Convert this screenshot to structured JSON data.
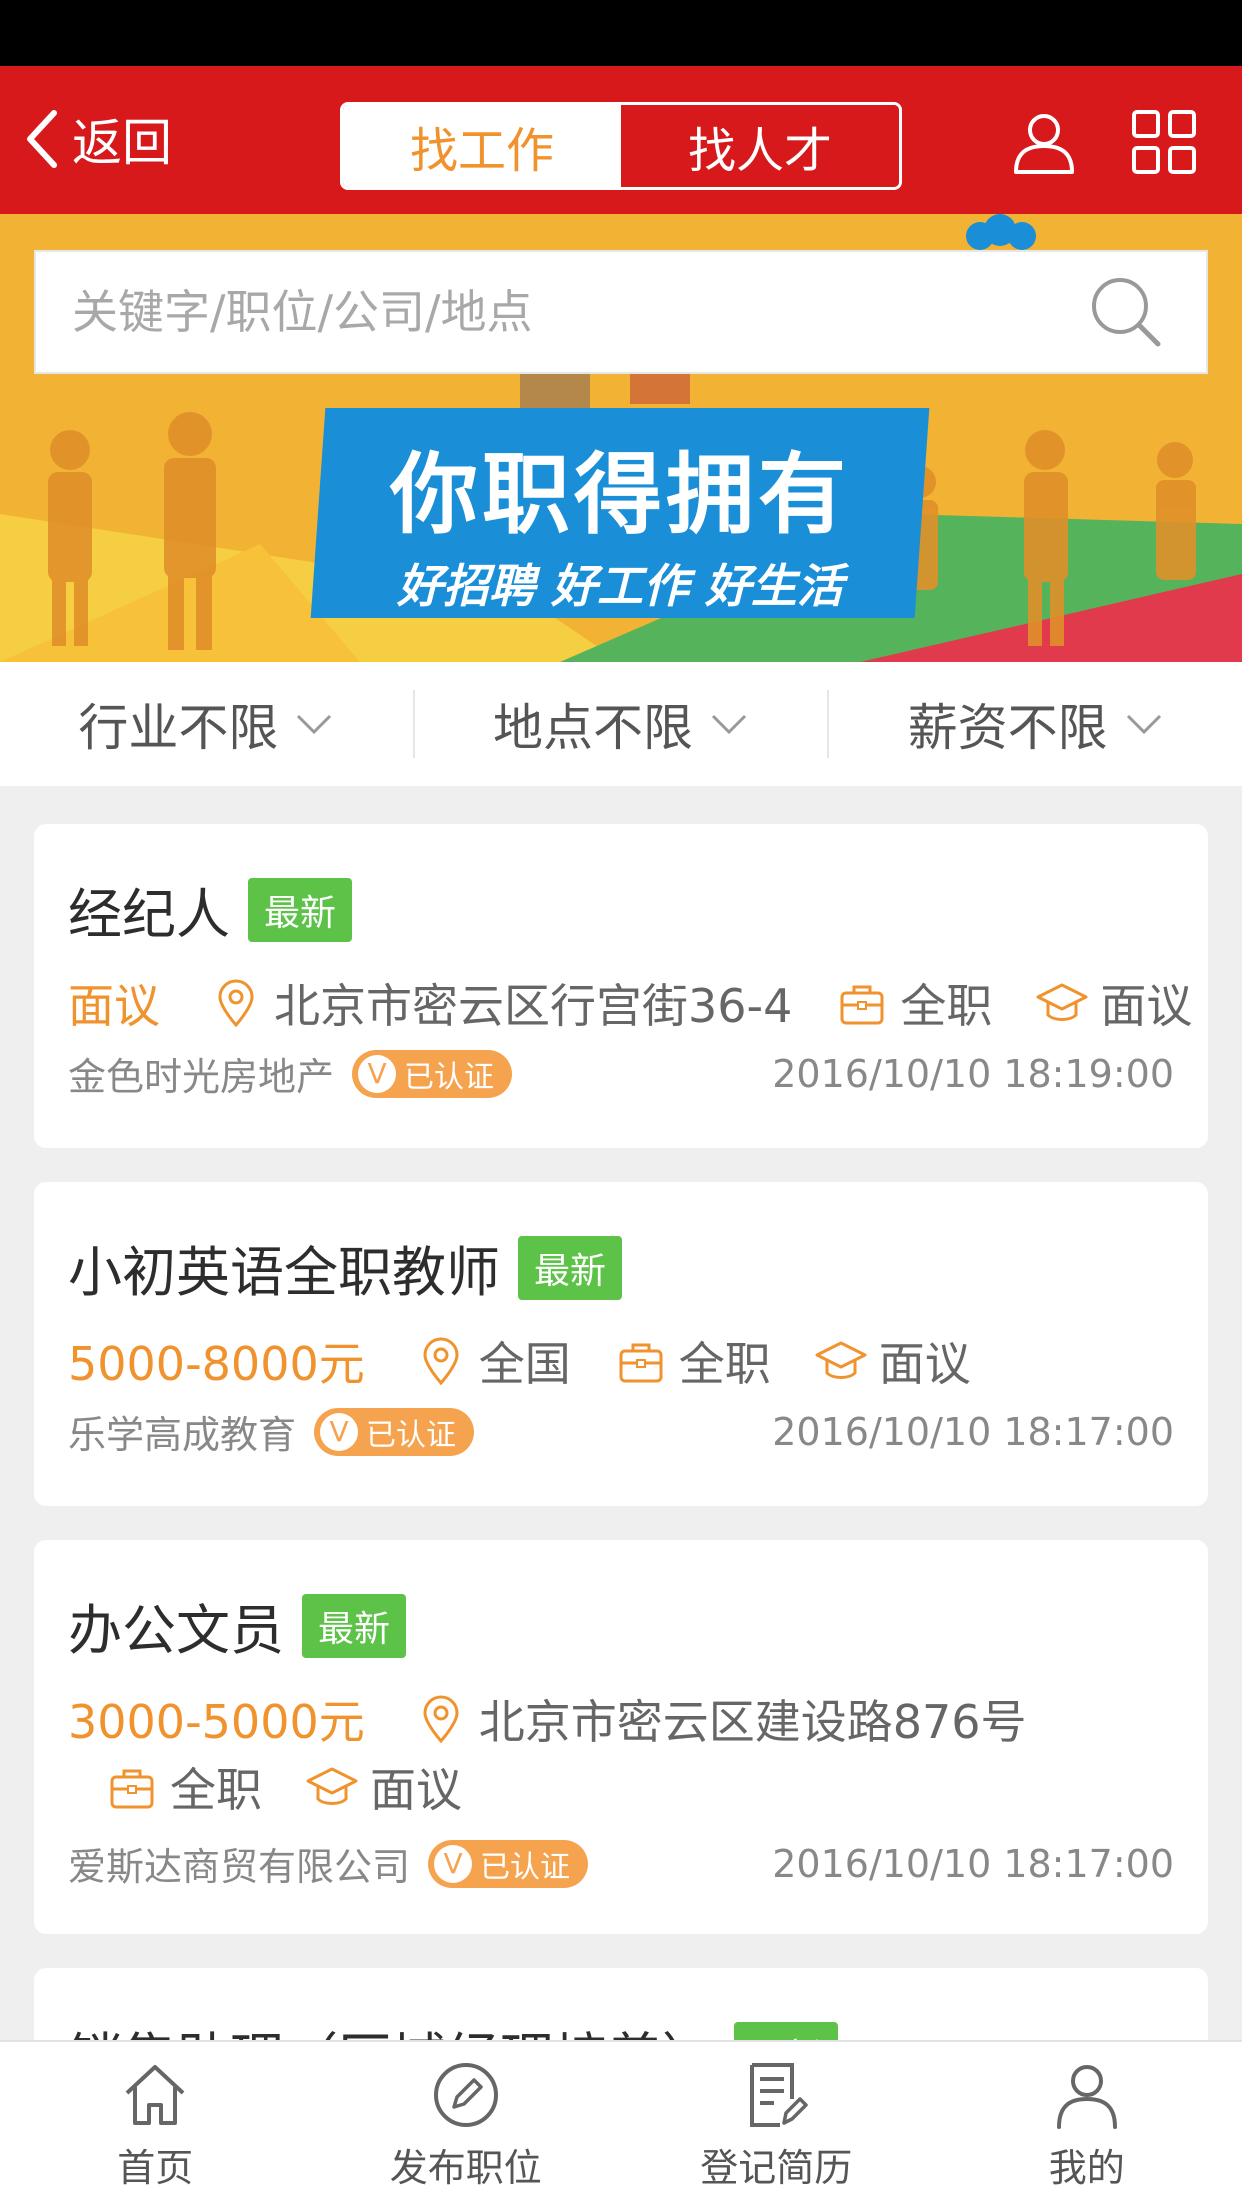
{
  "header": {
    "back_label": "返回",
    "tabs": [
      {
        "label": "找工作",
        "active": true
      },
      {
        "label": "找人才",
        "active": false
      }
    ]
  },
  "search": {
    "placeholder": "关键字/职位/公司/地点"
  },
  "banner": {
    "slogan_main": "你职得拥有",
    "slogan_sub": "好招聘 好工作 好生活"
  },
  "filters": [
    {
      "label": "行业不限"
    },
    {
      "label": "地点不限"
    },
    {
      "label": "薪资不限"
    }
  ],
  "jobs": [
    {
      "title": "经纪人",
      "badge": "最新",
      "salary": "面议",
      "location": "北京市密云区行宫街36-4",
      "type": "全职",
      "education": "面议",
      "company": "金色时光房地产",
      "verified_label": "已认证",
      "verified_mark": "V",
      "time": "2016/10/10 18:19:00"
    },
    {
      "title": "小初英语全职教师",
      "badge": "最新",
      "salary": "5000-8000元",
      "location": "全国",
      "type": "全职",
      "education": "面议",
      "company": "乐学高成教育",
      "verified_label": "已认证",
      "verified_mark": "V",
      "time": "2016/10/10 18:17:00"
    },
    {
      "title": "办公文员",
      "badge": "最新",
      "salary": "3000-5000元",
      "location": "北京市密云区建设路876号",
      "type": "全职",
      "education": "面议",
      "company": "爱斯达商贸有限公司",
      "verified_label": "已认证",
      "verified_mark": "V",
      "time": "2016/10/10 18:17:00"
    },
    {
      "title": "销售助理（区域经理培养）",
      "badge": "最新"
    }
  ],
  "tabbar": [
    {
      "label": "首页",
      "icon": "home-icon"
    },
    {
      "label": "发布职位",
      "icon": "edit-circle-icon"
    },
    {
      "label": "登记简历",
      "icon": "resume-icon"
    },
    {
      "label": "我的",
      "icon": "user-icon"
    }
  ],
  "colors": {
    "brand_red": "#d7191c",
    "accent_orange": "#f0932e",
    "badge_green": "#5cc248"
  }
}
